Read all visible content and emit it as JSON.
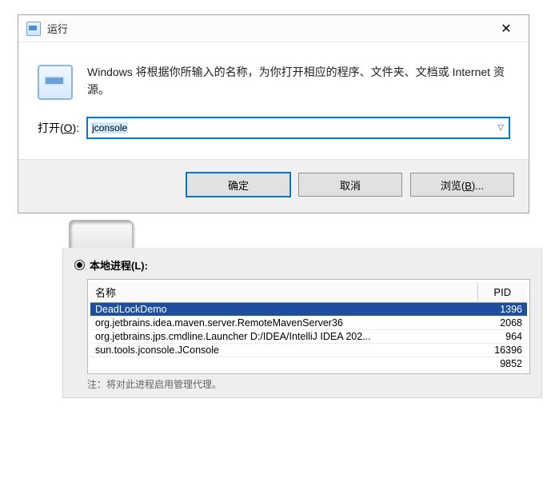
{
  "run": {
    "title": "运行",
    "description": "Windows 将根据你所输入的名称，为你打开相应的程序、文件夹、文档或 Internet 资源。",
    "open_label_prefix": "打开(",
    "open_label_hotkey": "O",
    "open_label_suffix": "):",
    "value": "jconsole",
    "ok": "确定",
    "cancel": "取消",
    "browse_prefix": "浏览(",
    "browse_hotkey": "B",
    "browse_suffix": ")..."
  },
  "jconsole": {
    "radio_label": "本地进程(L):",
    "columns": {
      "name": "名称",
      "pid": "PID"
    },
    "rows": [
      {
        "name": "DeadLockDemo",
        "pid": "1396",
        "selected": true
      },
      {
        "name": "org.jetbrains.idea.maven.server.RemoteMavenServer36",
        "pid": "2068",
        "selected": false
      },
      {
        "name": "org.jetbrains.jps.cmdline.Launcher D:/IDEA/IntelliJ IDEA 202...",
        "pid": "964",
        "selected": false
      },
      {
        "name": "sun.tools.jconsole.JConsole",
        "pid": "16396",
        "selected": false
      },
      {
        "name": "",
        "pid": "9852",
        "selected": false
      }
    ],
    "note": "注：将对此进程启用管理代理。"
  }
}
